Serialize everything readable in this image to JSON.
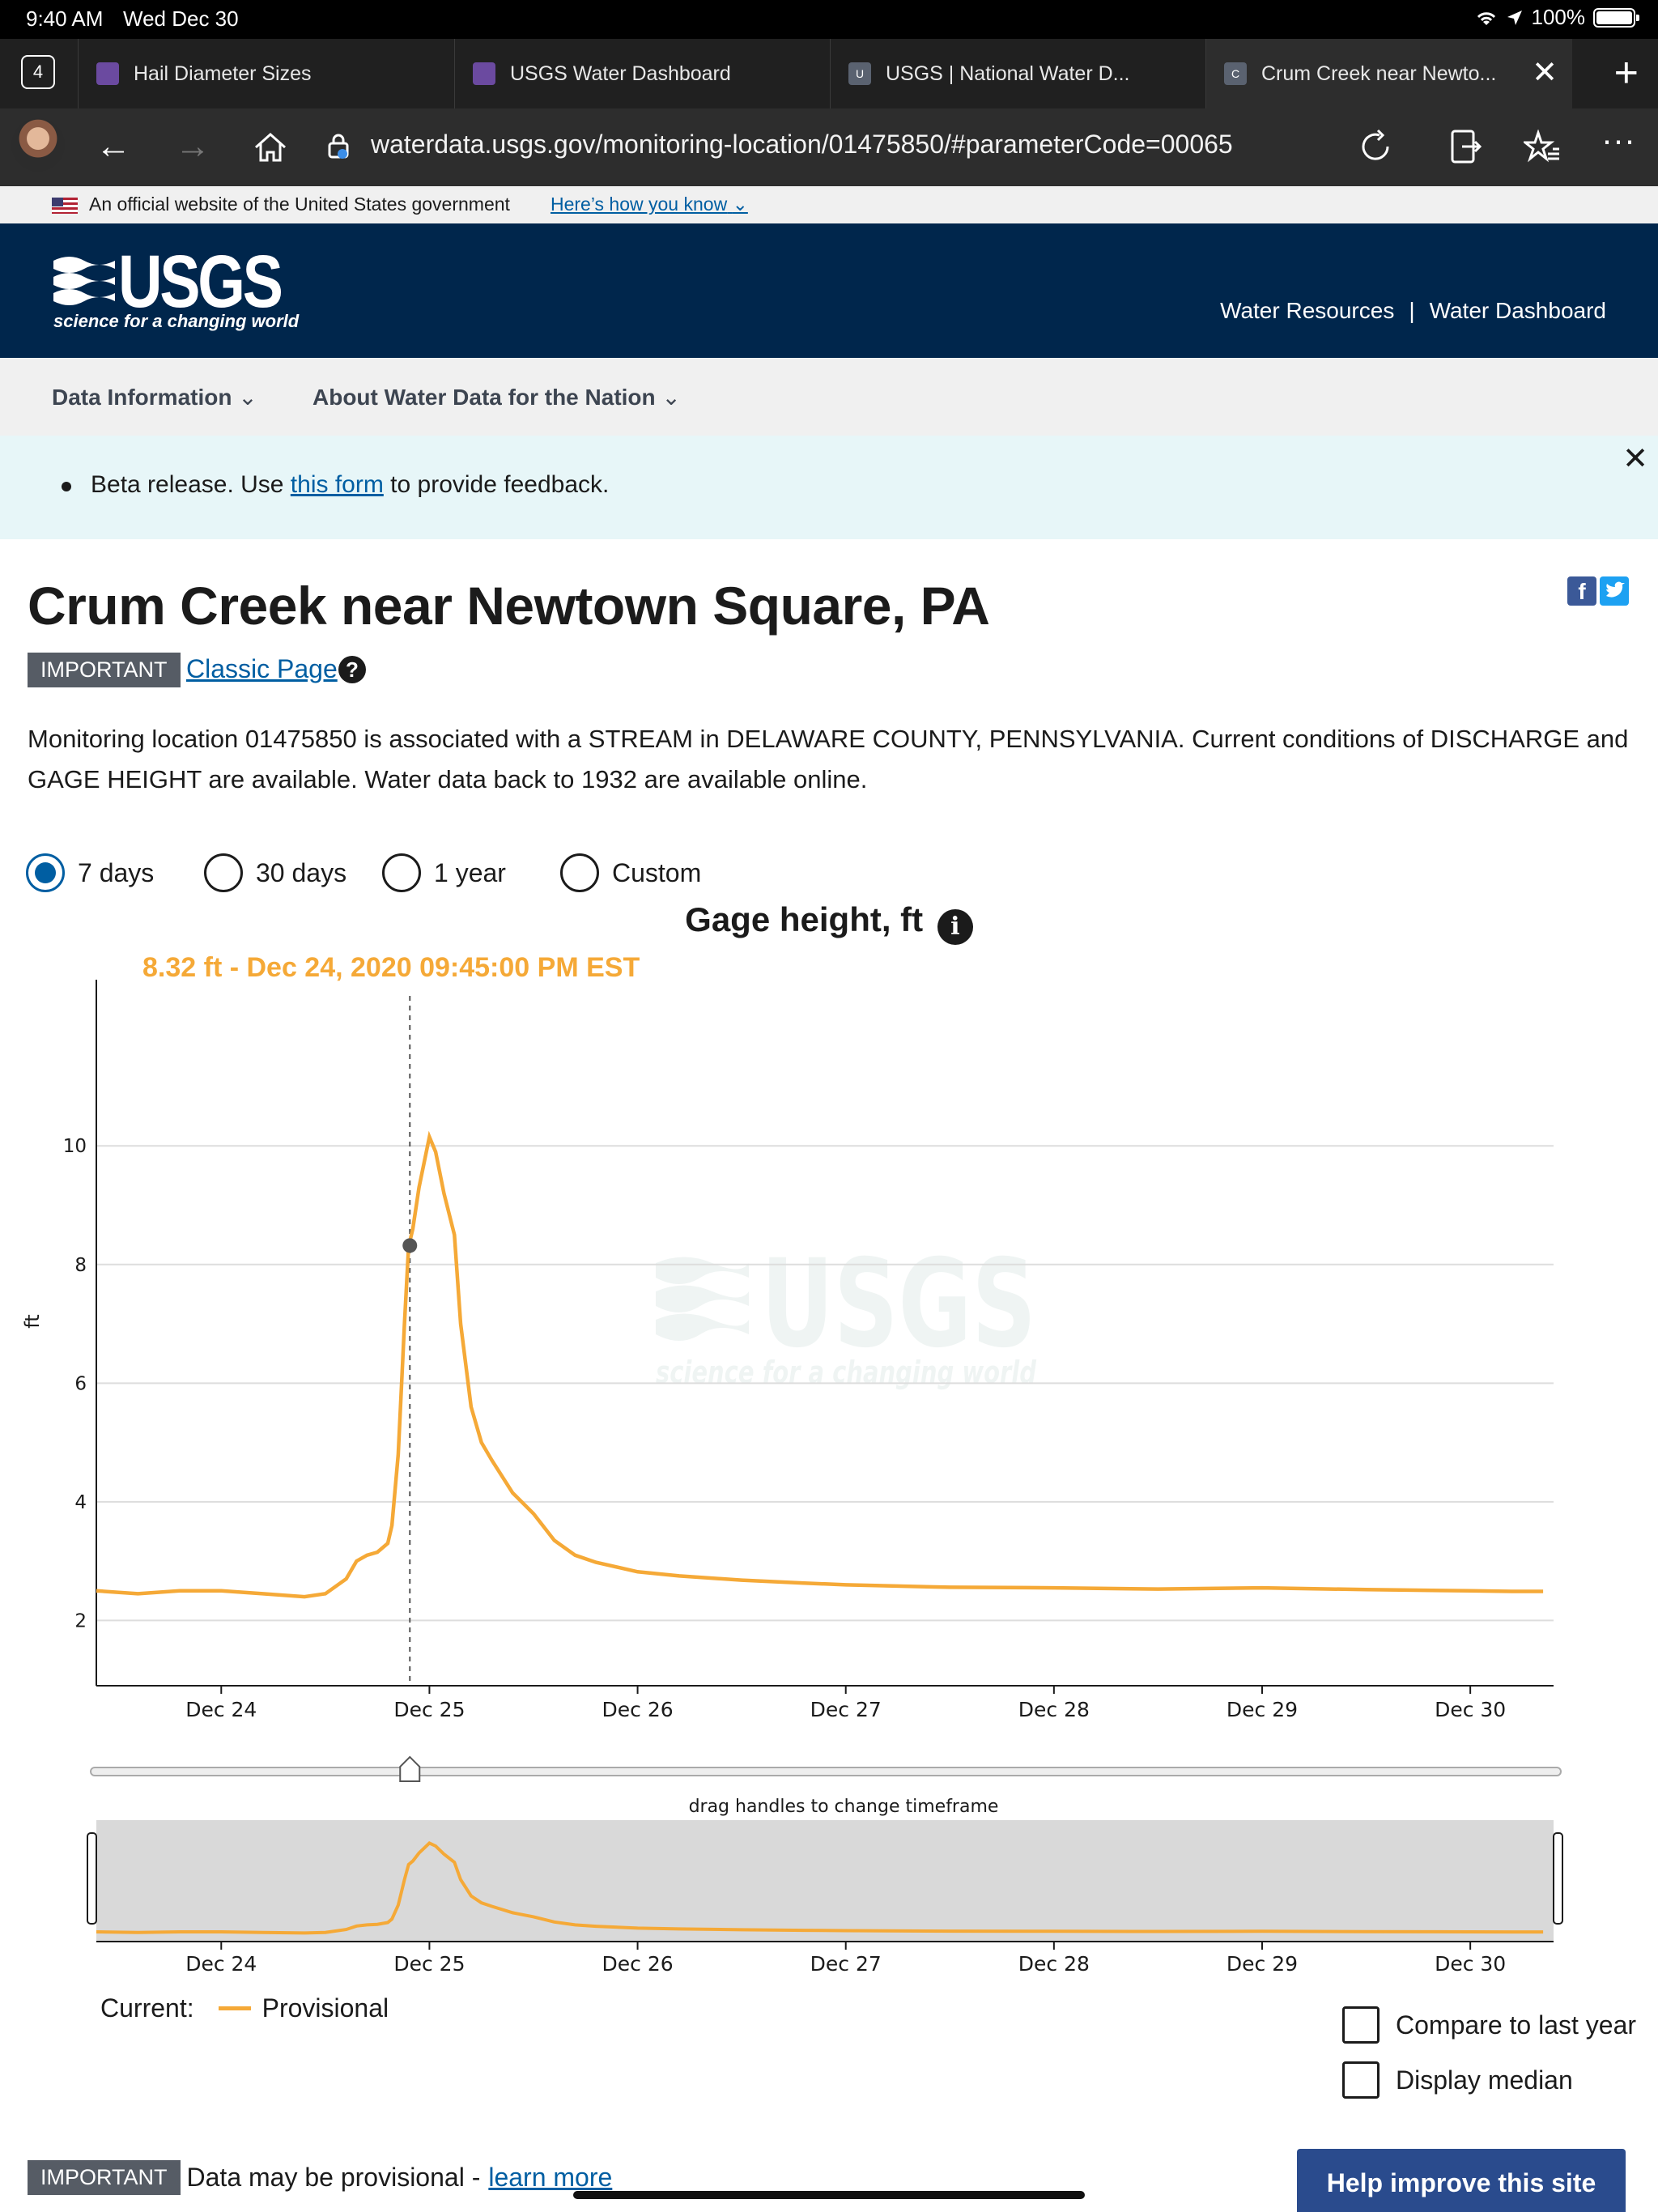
{
  "status": {
    "time": "9:40 AM",
    "date": "Wed Dec 30",
    "battery": "100%"
  },
  "tabs": {
    "count": "4",
    "items": [
      {
        "label": "Hail Diameter Sizes",
        "favicon_color": "#6b4aa0"
      },
      {
        "label": "USGS Water Dashboard",
        "favicon_color": "#6b4aa0"
      },
      {
        "label": "USGS | National Water D...",
        "favicon_color": "#5a6270",
        "favicon_letter": "U"
      },
      {
        "label": "Crum Creek near Newto...",
        "favicon_color": "#5a6270",
        "favicon_letter": "C"
      }
    ]
  },
  "address": {
    "url": "waterdata.usgs.gov/monitoring-location/01475850/#parameterCode=00065"
  },
  "gov_banner": {
    "text": "An official website of the United States government",
    "link": "Here’s how you know"
  },
  "header": {
    "logo_word": "USGS",
    "logo_tagline": "science for a changing world",
    "links": [
      "Water Resources",
      "Water Dashboard"
    ]
  },
  "subnav": {
    "items": [
      "Data Information",
      "About Water Data for the Nation"
    ]
  },
  "beta": {
    "prefix": "Beta release. Use ",
    "link": "this form",
    "suffix": " to provide feedback.",
    "close": "✕"
  },
  "page": {
    "title": "Crum Creek near Newtown Square, PA",
    "important_label": "IMPORTANT",
    "classic_link": "Classic Page",
    "description": "Monitoring location 01475850 is associated with a STREAM in DELAWARE COUNTY, PENNSYLVANIA. Current conditions of DISCHARGE and GAGE HEIGHT are available. Water data back to 1932 are available online."
  },
  "time_range": {
    "options": [
      "7 days",
      "30 days",
      "1 year",
      "Custom"
    ],
    "selected": "7 days"
  },
  "chart_data": {
    "type": "line",
    "title": "Gage height, ft",
    "tooltip": "8.32 ft - Dec 24, 2020 09:45:00 PM EST",
    "ylabel": "ft",
    "ylim": [
      0.9,
      11.6
    ],
    "yticks": [
      2,
      4,
      6,
      8,
      10
    ],
    "xlim": [
      23.4,
      30.4
    ],
    "xticks": [
      "Dec 24",
      "Dec 25",
      "Dec 26",
      "Dec 27",
      "Dec 28",
      "Dec 29",
      "Dec 30"
    ],
    "xtick_values": [
      24,
      25,
      26,
      27,
      28,
      29,
      30
    ],
    "cursor": {
      "x": 24.906,
      "y": 8.32
    },
    "brush_label": "drag handles to change timeframe",
    "series": [
      {
        "name": "Provisional",
        "color": "#f5a937",
        "x": [
          23.4,
          23.6,
          23.8,
          24.0,
          24.2,
          24.4,
          24.5,
          24.6,
          24.65,
          24.7,
          24.75,
          24.8,
          24.82,
          24.85,
          24.88,
          24.9,
          24.92,
          24.95,
          25.0,
          25.03,
          25.07,
          25.12,
          25.15,
          25.2,
          25.25,
          25.3,
          25.4,
          25.5,
          25.6,
          25.7,
          25.8,
          26.0,
          26.2,
          26.5,
          26.8,
          27.0,
          27.5,
          28.0,
          28.5,
          29.0,
          29.5,
          30.0,
          30.2,
          30.35
        ],
        "y": [
          2.5,
          2.45,
          2.5,
          2.5,
          2.45,
          2.4,
          2.45,
          2.7,
          3.0,
          3.1,
          3.15,
          3.3,
          3.6,
          4.8,
          7.0,
          8.3,
          8.6,
          9.3,
          10.15,
          9.9,
          9.2,
          8.5,
          7.0,
          5.6,
          5.0,
          4.7,
          4.15,
          3.8,
          3.35,
          3.1,
          2.98,
          2.82,
          2.75,
          2.68,
          2.63,
          2.6,
          2.56,
          2.55,
          2.53,
          2.55,
          2.52,
          2.5,
          2.49,
          2.49
        ]
      }
    ]
  },
  "legend": {
    "current_label": "Current:",
    "series_label": "Provisional"
  },
  "options": {
    "compare": "Compare to last year",
    "median": "Display median"
  },
  "footer": {
    "important_label": "IMPORTANT",
    "note": "Data may be provisional -",
    "learn_more": "learn more",
    "help_button": "Help improve this site"
  },
  "colors": {
    "accent": "#005ea2",
    "header": "#00264c",
    "series": "#f5a937"
  }
}
